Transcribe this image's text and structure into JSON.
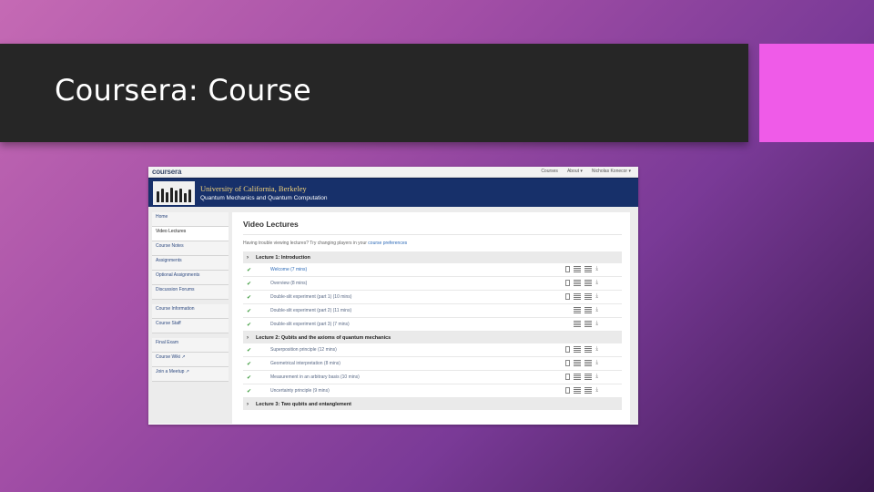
{
  "slide": {
    "title": "Coursera: Course"
  },
  "topnav": {
    "logo": "coursera",
    "items": [
      "Courses",
      "About ▾",
      "Nicholas Konecor ▾"
    ]
  },
  "banner": {
    "university": "University of California, Berkeley",
    "course": "Quantum Mechanics and Quantum Computation"
  },
  "sidebar": {
    "groups": [
      [
        "Home",
        "Video Lectures",
        "Course Notes",
        "Assignments",
        "Optional Assignments",
        "Discussion Forums"
      ],
      [
        "Course Information",
        "Course Staff"
      ],
      [
        "Final Exam",
        "Course Wiki ↗",
        "Join a Meetup ↗"
      ]
    ]
  },
  "main": {
    "heading": "Video Lectures",
    "hint_prefix": "Having trouble viewing lectures? Try changing players in your",
    "hint_link": "course preferences",
    "lectures": [
      {
        "title": "Lecture 1: Introduction",
        "videos": [
          {
            "title": "Welcome (7 mins)",
            "link": true,
            "doc": true
          },
          {
            "title": "Overview (8 mins)",
            "link": false,
            "doc": true
          },
          {
            "title": "Double-slit experiment (part 1) (10 mins)",
            "link": false,
            "doc": true
          },
          {
            "title": "Double-slit experiment (part 2) (11 mins)",
            "link": false,
            "doc": false
          },
          {
            "title": "Double-slit experiment (part 3) (7 mins)",
            "link": false,
            "doc": false
          }
        ]
      },
      {
        "title": "Lecture 2: Qubits and the axioms of quantum mechanics",
        "videos": [
          {
            "title": "Superposition principle (12 mins)",
            "link": false,
            "doc": true
          },
          {
            "title": "Geometrical interpretation (8 mins)",
            "link": false,
            "doc": true
          },
          {
            "title": "Measurement in an arbitrary basis (10 mins)",
            "link": false,
            "doc": true
          },
          {
            "title": "Uncertainty principle (9 mins)",
            "link": false,
            "doc": true
          }
        ]
      },
      {
        "title": "Lecture 3: Two qubits and entanglement",
        "videos": []
      }
    ]
  },
  "colors": {
    "title_bar": "#262626",
    "accent": "#ef5be8",
    "banner": "#17306a",
    "univ_gold": "#f1d27a",
    "link_blue": "#2e6bb8",
    "check_green": "#3a9a3a"
  }
}
